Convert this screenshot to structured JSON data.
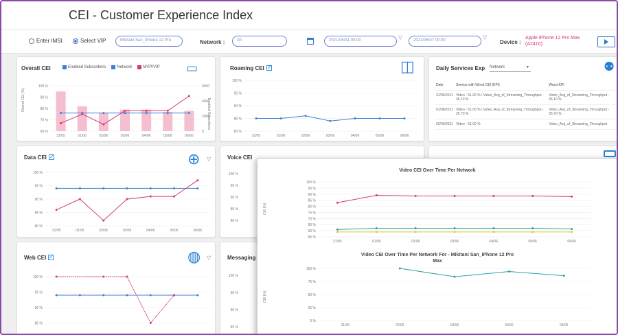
{
  "header": {
    "title": "CEI - Customer Experience Index"
  },
  "controls": {
    "enter_imsi": "Enter IMSI",
    "select_vip": "Select VIP",
    "vip_value": "Mikitani San_iPhone 12 Pro",
    "network_label": "Network :",
    "network_value": "All",
    "date_from": "2021/05/31 00:00",
    "date_to": "2021/06/07 00:00",
    "device_label": "Device :",
    "device_value_line1": "Apple iPhone 12 Pro Max",
    "device_value_line2": "(A2410)"
  },
  "overall": {
    "title": "Overall CEI",
    "legend": [
      "Enabled Subscribers",
      "Network",
      "MVP/VIP"
    ],
    "ylabel_left": "Overall CEI (%)",
    "ylabel_right": "Enabled Subscribers",
    "y_ticks": [
      "100 %",
      "90 %",
      "80 %",
      "70 %",
      "60 %"
    ],
    "y2_ticks": [
      "6000",
      "4000",
      "2000",
      "0"
    ],
    "x_ticks": [
      "31/05",
      "01/06",
      "02/06",
      "03/06",
      "04/06",
      "05/06",
      "06/06"
    ]
  },
  "roaming": {
    "title": "Roaming CEI",
    "y_ticks": [
      "100 %",
      "95 %",
      "90 %",
      "85 %",
      "80 %"
    ],
    "x_ticks": [
      "31/05",
      "01/06",
      "02/06",
      "03/06",
      "04/06",
      "05/06",
      "06/06"
    ]
  },
  "daily": {
    "title": "Daily Services Exp",
    "select": "Network",
    "headers": [
      "Date",
      "Service with Worst CEI (KPI)",
      "Worst KPI"
    ],
    "rows": [
      [
        "31/05/2021",
        "Video - 51.00 % / Video_Avg_of_Streaming_Throughput - 36.10 %",
        "Video_Avg_of_Streaming_Throughput - 36.10 %"
      ],
      [
        "01/06/2021",
        "Video - 51.00 % / Video_Avg_of_Streaming_Throughput - 35.70 %",
        "Video_Avg_of_Streaming_Throughput - 35.70 %"
      ],
      [
        "02/06/2021",
        "Video - 51.00 %",
        "Video_Avg_of_Streaming_Throughput"
      ]
    ]
  },
  "data_cei": {
    "title": "Data CEI",
    "y_ticks": [
      "100 %",
      "95 %",
      "90 %",
      "85 %",
      "80 %"
    ],
    "x_ticks": [
      "31/05",
      "01/06",
      "02/06",
      "03/06",
      "04/06",
      "05/06",
      "06/06"
    ]
  },
  "voice_cei": {
    "title": "Voice CEI",
    "y_ticks": [
      "100 %",
      "95 %",
      "90 %",
      "85 %",
      "80 %"
    ]
  },
  "web_cei": {
    "title": "Web CEI",
    "y_ticks": [
      "100 %",
      "95 %",
      "90 %",
      "85 %",
      "80 %"
    ]
  },
  "messaging": {
    "title": "Messaging",
    "y_ticks": [
      "100 %",
      "95 %",
      "90 %",
      "85 %"
    ]
  },
  "popup": {
    "title1": "Video CEI Over Time Per Network",
    "title2_line1": "Video CEI Over Time Per Network For - Mikitani San_iPhone 12 Pro",
    "title2_line2": "Max",
    "ylabel": "CEI (%)",
    "y_ticks1": [
      "100 %",
      "95 %",
      "90 %",
      "85 %",
      "80 %",
      "75 %",
      "70 %",
      "65 %",
      "60 %",
      "55 %"
    ],
    "x_ticks1": [
      "31/05",
      "01/06",
      "02/06",
      "03/06",
      "04/06",
      "05/06",
      "06/06"
    ],
    "y_ticks2": [
      "100 %",
      "75 %",
      "50 %",
      "25 %",
      "0 %"
    ],
    "x_ticks2": [
      "31/05",
      "02/06",
      "03/06",
      "04/06",
      "05/06"
    ]
  },
  "colors": {
    "accent": "#d0397a",
    "network": "#3d7fd6",
    "bar": "#f5bfd0",
    "frame": "#8b4aa3",
    "teal": "#2aa3a3",
    "yellow": "#e3c83a"
  },
  "chart_data": [
    {
      "type": "bar",
      "title": "Overall CEI",
      "categories": [
        "31/05",
        "01/06",
        "02/06",
        "03/06",
        "04/06",
        "05/06",
        "06/06"
      ],
      "series": [
        {
          "name": "Enabled Subscribers",
          "values": [
            95,
            82,
            76,
            79,
            79,
            77,
            78
          ]
        },
        {
          "name": "Network",
          "values": [
            76,
            76,
            76,
            76,
            76,
            76,
            76
          ]
        },
        {
          "name": "MVP/VIP",
          "values": [
            67,
            75,
            66,
            78,
            78,
            78,
            91
          ]
        }
      ],
      "ylim": [
        60,
        100
      ]
    },
    {
      "type": "line",
      "title": "Roaming CEI",
      "categories": [
        "31/05",
        "01/06",
        "02/06",
        "03/06",
        "04/06",
        "05/06",
        "06/06"
      ],
      "series": [
        {
          "values": [
            85,
            85,
            86,
            84,
            85,
            85,
            85
          ]
        }
      ],
      "ylim": [
        80,
        100
      ]
    },
    {
      "type": "line",
      "title": "Data CEI",
      "categories": [
        "31/05",
        "01/06",
        "02/06",
        "03/06",
        "04/06",
        "05/06",
        "06/06"
      ],
      "series": [
        {
          "values": [
            94,
            94,
            94,
            94,
            94,
            94,
            94
          ]
        },
        {
          "values": [
            86,
            90,
            82,
            90,
            91,
            91,
            97
          ]
        }
      ],
      "ylim": [
        80,
        100
      ]
    },
    {
      "type": "line",
      "title": "Video CEI Over Time Per Network",
      "categories": [
        "31/05",
        "01/06",
        "02/06",
        "03/06",
        "04/06",
        "05/06",
        "06/06"
      ],
      "series": [
        {
          "values": [
            83,
            89,
            88.5,
            88.5,
            88.5,
            88.5,
            88
          ]
        },
        {
          "values": [
            61,
            62,
            62,
            62,
            62,
            62,
            61.5
          ]
        },
        {
          "values": [
            59,
            59,
            59,
            59,
            59,
            59,
            59
          ]
        }
      ],
      "ylim": [
        55,
        100
      ]
    },
    {
      "type": "line",
      "title": "Video CEI Over Time Per Network For - Mikitani San_iPhone 12 Pro Max",
      "categories": [
        "31/05",
        "02/06",
        "03/06",
        "04/06",
        "05/06"
      ],
      "series": [
        {
          "values": [
            null,
            100,
            84,
            94,
            86
          ]
        }
      ],
      "ylim": [
        0,
        100
      ]
    }
  ]
}
